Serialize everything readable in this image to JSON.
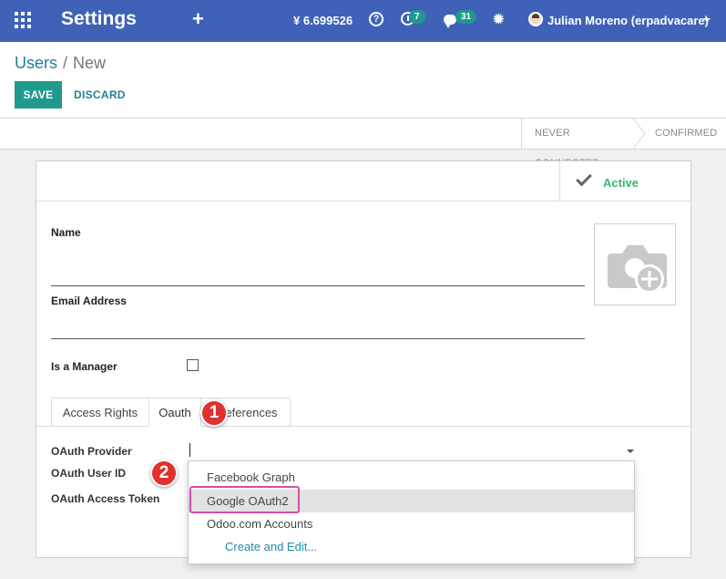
{
  "navbar": {
    "title": "Settings",
    "plus": "+",
    "balance": "¥ 6.699526",
    "help_glyph": "?",
    "activity_badge": "7",
    "chat_badge": "31",
    "bug_glyph": "✹",
    "user": "Julian Moreno (erpadvacare)"
  },
  "breadcrumb": {
    "parent": "Users",
    "separator": "/",
    "current": "New"
  },
  "buttons": {
    "save": "SAVE",
    "discard": "DISCARD"
  },
  "statusbar": {
    "stages": [
      "NEVER CONNECTED",
      "CONFIRMED"
    ]
  },
  "form": {
    "active_label": "Active",
    "name_label": "Name",
    "email_label": "Email Address",
    "manager_label": "Is a Manager",
    "tabs": [
      "Access Rights",
      "Oauth",
      "Preferences"
    ],
    "oauth_provider_label": "OAuth Provider",
    "oauth_user_id_label": "OAuth User ID",
    "oauth_token_label": "OAuth Access Token"
  },
  "dropdown": {
    "options": [
      "Facebook Graph",
      "Google OAuth2",
      "Odoo.com Accounts"
    ],
    "create_edit": "Create and Edit..."
  },
  "markers": [
    "1",
    "2"
  ],
  "colors": {
    "navbar": "#3f62b8",
    "primary": "#1f9a8c",
    "link": "#1f7f9a",
    "active": "#3cb371",
    "marker": "#e0312f",
    "highlight": "#d04fa8"
  }
}
